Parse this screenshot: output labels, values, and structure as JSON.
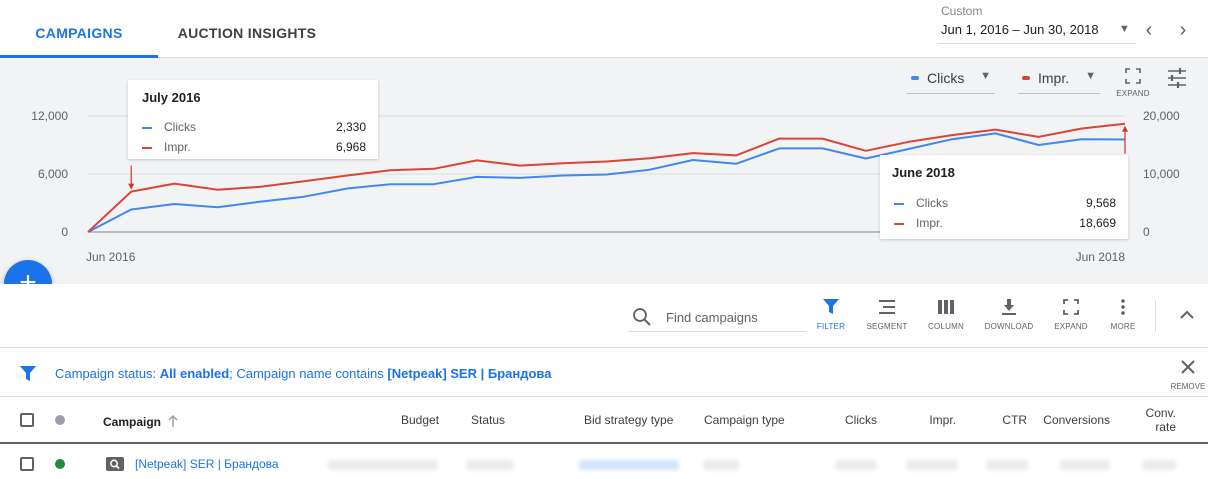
{
  "tabs": [
    {
      "label": "CAMPAIGNS",
      "active": true
    },
    {
      "label": "AUCTION INSIGHTS",
      "active": false
    }
  ],
  "date_range": {
    "label": "Custom",
    "value": "Jun 1, 2016 – Jun 30, 2018"
  },
  "chart_controls": {
    "metric1": "Clicks",
    "metric2": "Impr.",
    "expand_label": "EXPAND"
  },
  "colors": {
    "clicks": "#4285f4",
    "impr": "#db4437",
    "accent": "#1a73e8"
  },
  "tooltips": {
    "first": {
      "title": "July 2016",
      "rows": [
        {
          "name": "Clicks",
          "value": "2,330"
        },
        {
          "name": "Impr.",
          "value": "6,968"
        }
      ]
    },
    "last": {
      "title": "June 2018",
      "rows": [
        {
          "name": "Clicks",
          "value": "9,568"
        },
        {
          "name": "Impr.",
          "value": "18,669"
        }
      ]
    }
  },
  "chart_data": {
    "type": "line",
    "x": [
      "Jun 2016",
      "Jul 2016",
      "Aug 2016",
      "Sep 2016",
      "Oct 2016",
      "Nov 2016",
      "Dec 2016",
      "Jan 2017",
      "Feb 2017",
      "Mar 2017",
      "Apr 2017",
      "May 2017",
      "Jun 2017",
      "Jul 2017",
      "Aug 2017",
      "Sep 2017",
      "Oct 2017",
      "Nov 2017",
      "Dec 2017",
      "Jan 2018",
      "Feb 2018",
      "Mar 2018",
      "Apr 2018",
      "May 2018",
      "Jun 2018"
    ],
    "x_tick_labels": [
      "Jun 2016",
      "Jun 2018"
    ],
    "series": [
      {
        "name": "Clicks",
        "axis": "left",
        "values": [
          0,
          2330,
          2900,
          2550,
          3150,
          3650,
          4500,
          4950,
          4950,
          5700,
          5600,
          5850,
          5950,
          6450,
          7450,
          7050,
          8650,
          8650,
          7600,
          8600,
          9600,
          10200,
          9000,
          9600,
          9568
        ]
      },
      {
        "name": "Impr.",
        "axis": "right",
        "values": [
          0,
          6968,
          8350,
          7300,
          7800,
          8750,
          9750,
          10650,
          10900,
          12350,
          11450,
          11850,
          12150,
          12700,
          13600,
          13200,
          16100,
          16100,
          14000,
          15550,
          16700,
          17650,
          16400,
          17850,
          18669
        ]
      }
    ],
    "y_left": {
      "ticks": [
        "0",
        "6,000",
        "12,000"
      ],
      "range": [
        0,
        12000
      ]
    },
    "y_right": {
      "ticks": [
        "0",
        "10,000",
        "20,000"
      ],
      "range": [
        0,
        20000
      ]
    },
    "grid": true
  },
  "toolbar": {
    "search_placeholder": "Find campaigns",
    "buttons": [
      "FILTER",
      "SEGMENT",
      "COLUMN",
      "DOWNLOAD",
      "EXPAND",
      "MORE"
    ]
  },
  "filter": {
    "prefix": "Campaign status: ",
    "status": "All enabled",
    "middle": "; Campaign name contains ",
    "name": "[Netpeak] SER | Брандова",
    "remove_label": "REMOVE"
  },
  "table": {
    "headers": {
      "campaign": "Campaign",
      "budget": "Budget",
      "status": "Status",
      "bid_strategy": "Bid strategy type",
      "campaign_type": "Campaign type",
      "clicks": "Clicks",
      "impr": "Impr.",
      "ctr": "CTR",
      "conversions": "Conversions",
      "conv_rate_line1": "Conv.",
      "conv_rate_line2": "rate"
    },
    "rows": [
      {
        "campaign": "[Netpeak] SER | Брандова",
        "status_color": "#1e8e3e"
      }
    ]
  }
}
